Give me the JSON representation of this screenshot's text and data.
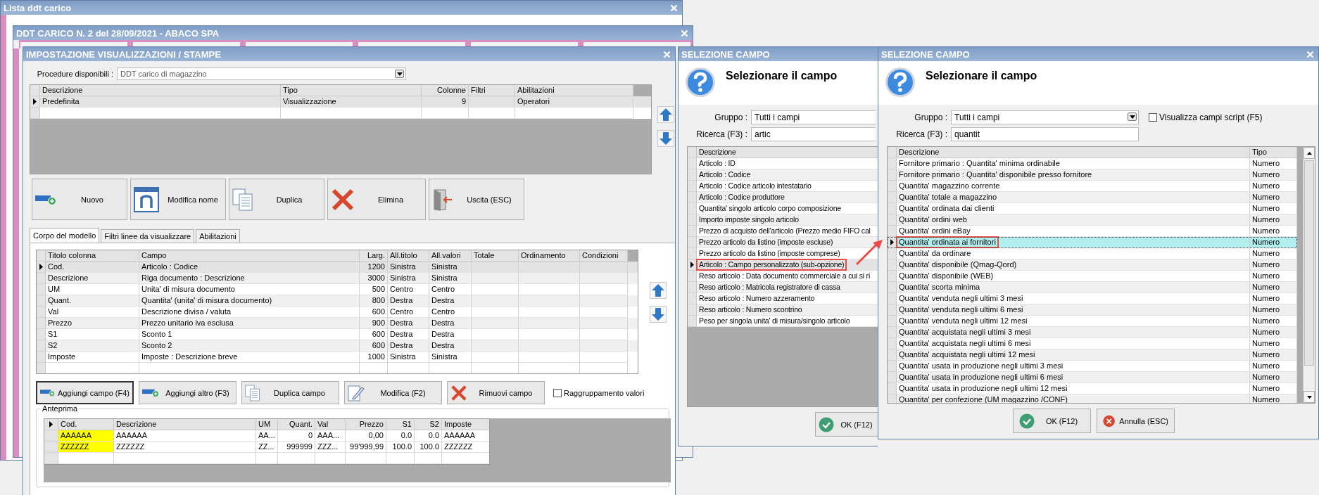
{
  "list_window": {
    "title": "Lista ddt carico"
  },
  "document_window": {
    "title": "DDT CARICO N. 2 del 28/09/2021 - ABACO SPA"
  },
  "settings_window": {
    "title": "IMPOSTAZIONE VISUALIZZAZIONI / STAMPE",
    "procedure": {
      "label": "Procedure disponibili :",
      "value": "DDT carico di magazzino"
    },
    "layouts_table": {
      "columns": [
        {
          "label": "Descrizione"
        },
        {
          "label": "Tipo"
        },
        {
          "label": "Colonne"
        },
        {
          "label": "Filtri"
        },
        {
          "label": "Abilitazioni"
        }
      ],
      "rows": [
        {
          "selected": true,
          "cells": [
            "Predefinita",
            "Visualizzazione",
            "9",
            null,
            "Operatori"
          ]
        }
      ]
    },
    "actions": [
      {
        "label": "Nuovo",
        "kind": "add"
      },
      {
        "label": "Modifica nome",
        "kind": "form"
      },
      {
        "label": "Duplica",
        "kind": "copy"
      },
      {
        "label": "Elimina",
        "kind": "delete"
      },
      {
        "label": "Uscita (ESC)",
        "kind": "exit"
      }
    ],
    "tabs": [
      {
        "label": "Corpo del modello",
        "selected": true
      },
      {
        "label": "Filtri linee da visualizzare",
        "selected": false
      },
      {
        "label": "Abilitazioni",
        "selected": false
      }
    ],
    "fields_table": {
      "columns": [
        {
          "label": "Titolo colonna"
        },
        {
          "label": "Campo"
        },
        {
          "label": "Larg."
        },
        {
          "label": "All.titolo"
        },
        {
          "label": "All.valori"
        },
        {
          "label": "Totale"
        },
        {
          "label": "Ordinamento"
        },
        {
          "label": "Condizioni"
        }
      ],
      "rows": [
        {
          "selected": true,
          "cells": [
            "Cod.",
            "Articolo : Codice",
            "1200",
            "Sinistra",
            "Sinistra"
          ]
        },
        {
          "selected": false,
          "cells": [
            "Descrizione",
            "Riga documento : Descrizione",
            "3000",
            "Sinistra",
            "Sinistra"
          ]
        },
        {
          "selected": false,
          "cells": [
            "UM",
            "Unita' di misura documento",
            "500",
            "Centro",
            "Centro"
          ]
        },
        {
          "selected": false,
          "cells": [
            "Quant.",
            "Quantita' (unita' di misura documento)",
            "800",
            "Destra",
            "Destra"
          ]
        },
        {
          "selected": false,
          "cells": [
            "Val",
            "Descrizione divisa / valuta",
            "600",
            "Centro",
            "Centro"
          ]
        },
        {
          "selected": false,
          "cells": [
            "Prezzo",
            "Prezzo unitario iva esclusa",
            "900",
            "Destra",
            "Destra"
          ]
        },
        {
          "selected": false,
          "cells": [
            "S1",
            "Sconto 1",
            "600",
            "Destra",
            "Destra"
          ]
        },
        {
          "selected": false,
          "cells": [
            "S2",
            "Sconto 2",
            "600",
            "Destra",
            "Destra"
          ]
        },
        {
          "selected": false,
          "cells": [
            "Imposte",
            "Imposte : Descrizione breve",
            "1000",
            "Sinistra",
            "Sinistra"
          ]
        }
      ]
    },
    "field_actions": [
      {
        "label": "Aggiungi campo (F4)",
        "kind": "add",
        "focused": true
      },
      {
        "label": "Aggiungi altro (F3)",
        "kind": "add",
        "focused": false
      },
      {
        "label": "Duplica campo",
        "kind": "copy",
        "focused": false
      },
      {
        "label": "Modifica (F2)",
        "kind": "edit",
        "focused": false
      },
      {
        "label": "Rimuovi campo",
        "kind": "delete",
        "focused": false
      }
    ],
    "grouping": {
      "label": "Raggruppamento valori",
      "checked": false
    },
    "preview": {
      "title": "Anteprima",
      "columns": [
        {
          "label": "Cod.",
          "highlighted": true
        },
        {
          "label": "Descrizione",
          "highlighted": false
        },
        {
          "label": "UM",
          "highlighted": false
        },
        {
          "label": "Quant.",
          "highlighted": false
        },
        {
          "label": "Val",
          "highlighted": false
        },
        {
          "label": "Prezzo",
          "highlighted": false
        },
        {
          "label": "S1",
          "highlighted": false
        },
        {
          "label": "S2",
          "highlighted": false
        },
        {
          "label": "Imposte",
          "highlighted": false
        }
      ],
      "rows": [
        [
          "AAAAAA",
          "AAAAAA",
          "AA...",
          "0",
          "AAA...",
          "0,00",
          "0.0",
          "0.0",
          "AAAAAA"
        ],
        [
          "ZZZZZZ",
          "ZZZZZZ",
          "ZZ...",
          "999999",
          "ZZZ...",
          "99'999,99",
          "100.0",
          "100.0",
          "ZZZZZZ"
        ]
      ]
    }
  },
  "field_dialogs": [
    {
      "title": "SELEZIONE CAMPO",
      "heading": "Selezionare il campo",
      "group": {
        "label": "Gruppo :",
        "value": "Tutti i campi"
      },
      "search": {
        "label": "Ricerca (F3) :",
        "value": "artic"
      },
      "columns": [
        {
          "label": "Descrizione"
        }
      ],
      "rows": [
        {
          "selected": false,
          "highlighted": false,
          "cells": [
            "Articolo : ID"
          ]
        },
        {
          "selected": false,
          "highlighted": false,
          "cells": [
            "Articolo : Codice"
          ]
        },
        {
          "selected": false,
          "highlighted": false,
          "cells": [
            "Articolo : Codice articolo intestatario"
          ]
        },
        {
          "selected": false,
          "highlighted": false,
          "cells": [
            "Articolo : Codice produttore"
          ]
        },
        {
          "selected": false,
          "highlighted": false,
          "cells": [
            "Quantita' singolo articolo corpo composizione"
          ]
        },
        {
          "selected": false,
          "highlighted": false,
          "cells": [
            "Importo imposte singolo articolo"
          ]
        },
        {
          "selected": false,
          "highlighted": false,
          "cells": [
            "Prezzo di acquisto dell'articolo (Prezzo medio FIFO cal"
          ]
        },
        {
          "selected": false,
          "highlighted": false,
          "cells": [
            "Prezzo articolo da listino (imposte escluse)"
          ]
        },
        {
          "selected": false,
          "highlighted": false,
          "cells": [
            "Prezzo articolo da listino (imposte comprese)"
          ]
        },
        {
          "selected": true,
          "highlighted": true,
          "cells": [
            "Articolo : Campo personalizzato (sub-opzione)"
          ]
        },
        {
          "selected": false,
          "highlighted": false,
          "cells": [
            "Reso articolo : Data documento commerciale a cui si ri"
          ]
        },
        {
          "selected": false,
          "highlighted": false,
          "cells": [
            "Reso articolo : Matricola registratore di cassa"
          ]
        },
        {
          "selected": false,
          "highlighted": false,
          "cells": [
            "Reso articolo : Numero azzeramento"
          ]
        },
        {
          "selected": false,
          "highlighted": false,
          "cells": [
            "Reso articolo : Numero scontrino"
          ]
        },
        {
          "selected": false,
          "highlighted": false,
          "cells": [
            "Peso per singola unita' di misura/singolo articolo"
          ]
        }
      ],
      "buttons": [
        {
          "label": "OK (F12)",
          "kind": "ok"
        }
      ]
    },
    {
      "title": "SELEZIONE CAMPO",
      "heading": "Selezionare il campo",
      "group": {
        "label": "Gruppo :",
        "value": "Tutti i campi"
      },
      "script_toggle": {
        "label": "Visualizza campi script (F5)",
        "checked": false
      },
      "search": {
        "label": "Ricerca (F3) :",
        "value": "quantit"
      },
      "columns": [
        {
          "label": "Descrizione"
        },
        {
          "label": "Tipo"
        }
      ],
      "rows": [
        {
          "selected": false,
          "highlighted": false,
          "cells": [
            "Fornitore primario : Quantita' minima ordinabile",
            "Numero"
          ]
        },
        {
          "selected": false,
          "highlighted": false,
          "cells": [
            "Fornitore primario : Quantita' disponibile presso fornitore",
            "Numero"
          ]
        },
        {
          "selected": false,
          "highlighted": false,
          "cells": [
            "Quantita' magazzino corrente",
            "Numero"
          ]
        },
        {
          "selected": false,
          "highlighted": false,
          "cells": [
            "Quantita' totale a magazzino",
            "Numero"
          ]
        },
        {
          "selected": false,
          "highlighted": false,
          "cells": [
            "Quantita' ordinata dai clienti",
            "Numero"
          ]
        },
        {
          "selected": false,
          "highlighted": false,
          "cells": [
            "Quantita' ordini web",
            "Numero"
          ]
        },
        {
          "selected": false,
          "highlighted": false,
          "cells": [
            "Quantita' ordini eBay",
            "Numero"
          ]
        },
        {
          "selected": true,
          "highlighted": true,
          "cells": [
            "Quantita' ordinata ai fornitori",
            "Numero"
          ]
        },
        {
          "selected": false,
          "highlighted": false,
          "cells": [
            "Quantita' da ordinare",
            "Numero"
          ]
        },
        {
          "selected": false,
          "highlighted": false,
          "cells": [
            "Quantita' disponibile (Qmag-Qord)",
            "Numero"
          ]
        },
        {
          "selected": false,
          "highlighted": false,
          "cells": [
            "Quantita' disponibile (WEB)",
            "Numero"
          ]
        },
        {
          "selected": false,
          "highlighted": false,
          "cells": [
            "Quantita' scorta minima",
            "Numero"
          ]
        },
        {
          "selected": false,
          "highlighted": false,
          "cells": [
            "Quantita' venduta negli ultimi 3 mesi",
            "Numero"
          ]
        },
        {
          "selected": false,
          "highlighted": false,
          "cells": [
            "Quantita' venduta negli ultimi 6 mesi",
            "Numero"
          ]
        },
        {
          "selected": false,
          "highlighted": false,
          "cells": [
            "Quantita' venduta negli ultimi 12 mesi",
            "Numero"
          ]
        },
        {
          "selected": false,
          "highlighted": false,
          "cells": [
            "Quantita' acquistata negli ultimi 3 mesi",
            "Numero"
          ]
        },
        {
          "selected": false,
          "highlighted": false,
          "cells": [
            "Quantita' acquistata negli ultimi 6 mesi",
            "Numero"
          ]
        },
        {
          "selected": false,
          "highlighted": false,
          "cells": [
            "Quantita' acquistata negli ultimi 12 mesi",
            "Numero"
          ]
        },
        {
          "selected": false,
          "highlighted": false,
          "cells": [
            "Quantita' usata in produzione negli ultimi 3 mesi",
            "Numero"
          ]
        },
        {
          "selected": false,
          "highlighted": false,
          "cells": [
            "Quantita' usata in produzione negli ultimi 6 mesi",
            "Numero"
          ]
        },
        {
          "selected": false,
          "highlighted": false,
          "cells": [
            "Quantita' usata in produzione negli ultimi 12 mesi",
            "Numero"
          ]
        },
        {
          "selected": false,
          "highlighted": false,
          "cells": [
            "Quantita' per confezione (UM magazzino /CONF)",
            "Numero"
          ]
        }
      ],
      "buttons": [
        {
          "label": "OK (F12)",
          "kind": "ok"
        },
        {
          "label": "Annulla (ESC)",
          "kind": "cancel"
        }
      ]
    }
  ]
}
